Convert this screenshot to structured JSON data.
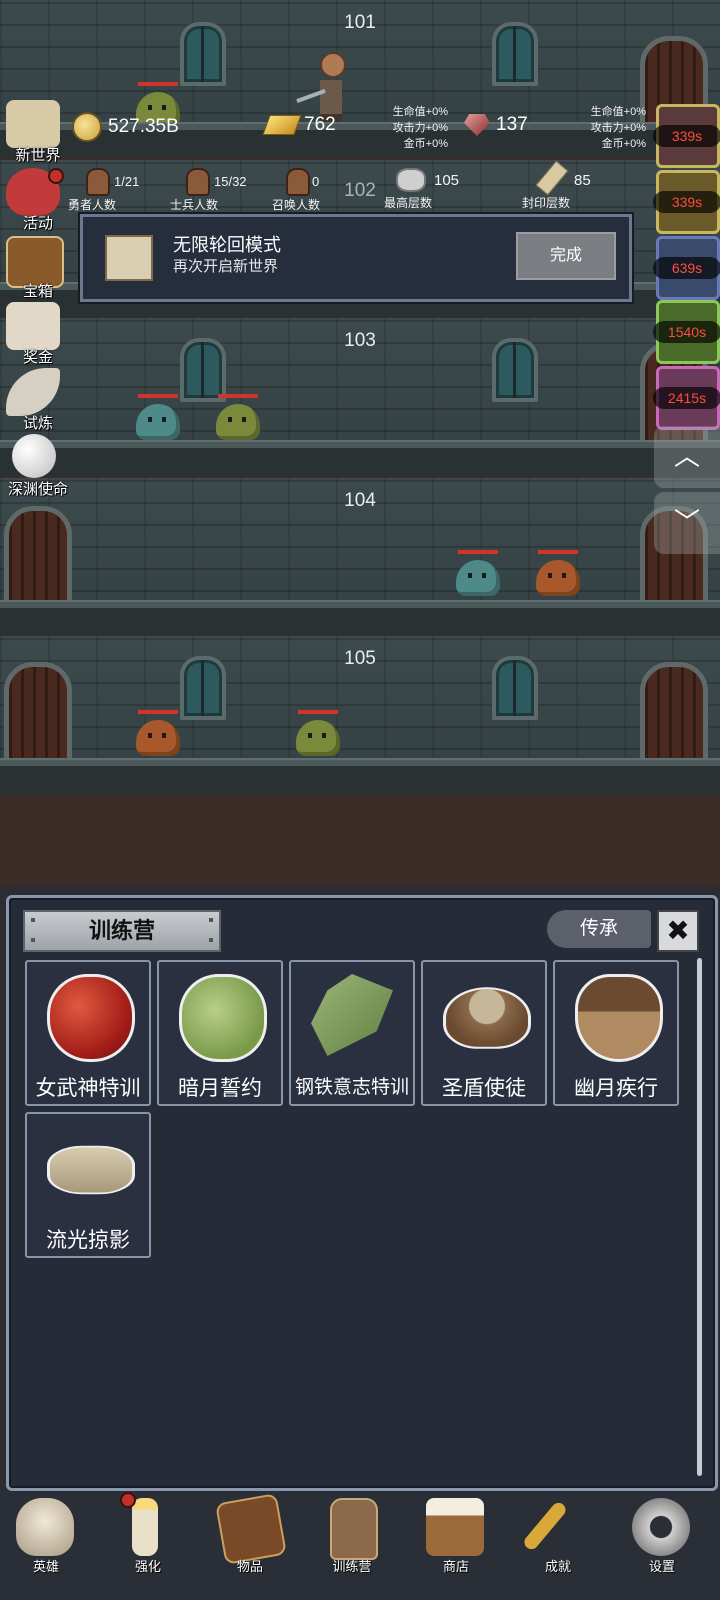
{
  "floors": [
    {
      "number": "101"
    },
    {
      "number": "102"
    },
    {
      "number": "103"
    },
    {
      "number": "104"
    },
    {
      "number": "105"
    }
  ],
  "resources": {
    "coins": "527.35B",
    "gold_bars": "762",
    "gems": "137"
  },
  "buffs_left": [
    "生命值+0%",
    "攻击力+0%",
    "金币+0%"
  ],
  "buffs_right": [
    "生命值+0%",
    "攻击力+0%",
    "金币+0%"
  ],
  "stats": [
    {
      "value": "1/21",
      "label": "勇者人数"
    },
    {
      "value": "15/32",
      "label": "士兵人数"
    },
    {
      "value": "0",
      "label": "召唤人数"
    },
    {
      "value": "105",
      "label": "最高层数"
    },
    {
      "value": "85",
      "label": "封印层数"
    }
  ],
  "left_menu": [
    "新世界",
    "活动",
    "宝箱",
    "奖金",
    "试炼",
    "深渊使命"
  ],
  "timers": [
    "339s",
    "339s",
    "639s",
    "1540s",
    "2415s"
  ],
  "toast": {
    "title": "无限轮回模式",
    "subtitle": "再次开启新世界",
    "button": "完成"
  },
  "panel": {
    "title": "训练营",
    "inherit": "传承",
    "close": "✖",
    "items": [
      "女武神特训",
      "暗月誓约",
      "钢铁意志特训",
      "圣盾使徒",
      "幽月疾行",
      "流光掠影"
    ]
  },
  "bottom_nav": [
    "英雄",
    "强化",
    "物品",
    "训练营",
    "商店",
    "成就",
    "设置"
  ],
  "icons": {
    "up": "︿",
    "down": "﹀"
  }
}
